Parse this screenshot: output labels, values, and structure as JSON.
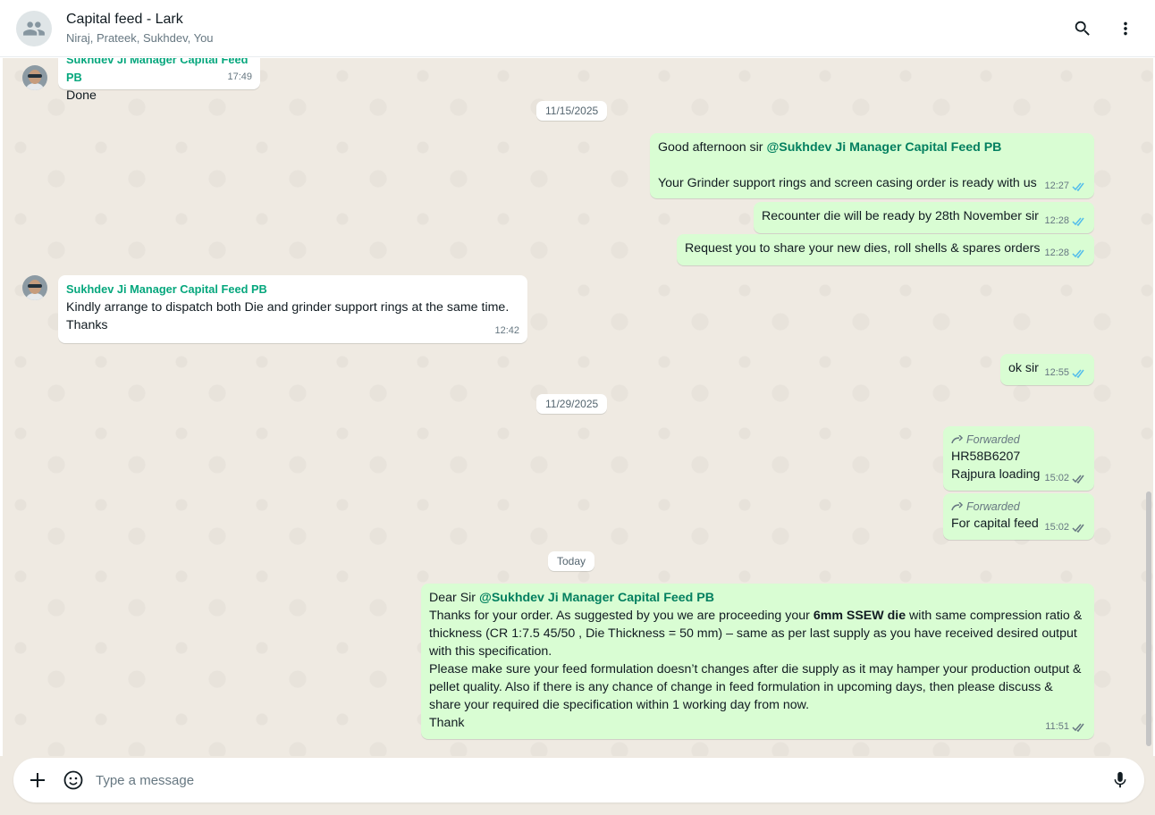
{
  "header": {
    "title": "Capital feed - Lark",
    "subtitle": "Niraj, Prateek, Sukhdev, You",
    "avatar_icon": "group-icon",
    "search_icon": "search-icon",
    "menu_icon": "more-vertical-icon"
  },
  "messages": {
    "m0": {
      "sender": "Sukhdev Ji Manager Capital Feed PB",
      "text": "Done",
      "time": "17:49"
    },
    "date1": "11/15/2025",
    "m1": {
      "greeting": "Good afternoon sir ",
      "mention": "@Sukhdev Ji Manager Capital Feed PB",
      "text": "Your Grinder support rings and screen casing order is ready with us",
      "time": "12:27"
    },
    "m2": {
      "text": "Recounter die will be ready by 28th November sir",
      "time": "12:28"
    },
    "m3": {
      "text": "Request you to share your new dies, roll shells & spares orders",
      "time": "12:28"
    },
    "m4": {
      "sender": "Sukhdev Ji Manager Capital Feed PB",
      "line1": "Kindly arrange to dispatch both  Die and grinder support rings at the same time.",
      "line2": "Thanks",
      "time": "12:42"
    },
    "m5": {
      "text": "ok sir",
      "time": "12:55"
    },
    "date2": "11/29/2025",
    "m6": {
      "forwarded": "Forwarded",
      "line1": "HR58B6207",
      "line2": "Rajpura loading",
      "time": "15:02"
    },
    "m7": {
      "forwarded": "Forwarded",
      "text": "For capital feed",
      "time": "15:02"
    },
    "date3": "Today",
    "m8": {
      "greeting": "Dear Sir ",
      "mention": "@Sukhdev Ji Manager Capital Feed PB",
      "p1a": "Thanks for your order. As suggested by you we are proceeding your ",
      "p1b": "6mm SSEW die",
      "p1c": " with same compression ratio & thickness (CR 1:7.5 45/50 , Die Thickness = 50 mm) – same as per last supply as you have received desired output with this specification.",
      "p2": "Please make sure your feed formulation doesn’t changes after die supply as it may hamper your production output & pellet quality. Also if there is any chance of change in feed formulation in upcoming days, then please discuss & share your required die specification within 1 working day from now.",
      "p3": "Thank",
      "time": "11:51"
    }
  },
  "composer": {
    "placeholder": "Type a message",
    "attach_icon": "plus-icon",
    "sticker_icon": "sticker-icon",
    "mic_icon": "mic-icon"
  },
  "colors": {
    "chat_bg": "#efeae2",
    "outgoing": "#d9fdd3",
    "incoming": "#ffffff",
    "sender_name": "#06a77d",
    "read_tick": "#53bdeb"
  }
}
